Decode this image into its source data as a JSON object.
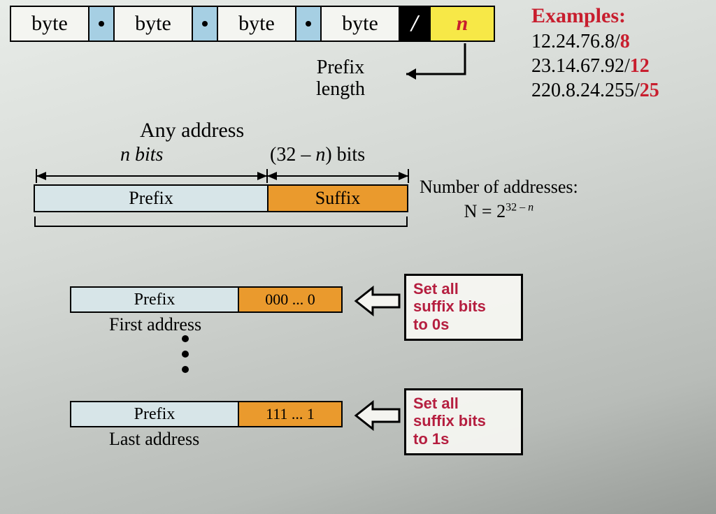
{
  "notation": {
    "byte": "byte",
    "slash": "/",
    "n": "n"
  },
  "examples": {
    "header": "Examples:",
    "rows": [
      {
        "ip": "12.24.76.8/",
        "suf": "8"
      },
      {
        "ip": "23.14.67.92/",
        "suf": "12"
      },
      {
        "ip": "220.8.24.255/",
        "suf": "25"
      }
    ]
  },
  "prefix_length": {
    "line1": "Prefix",
    "line2": "length"
  },
  "any_address": "Any address",
  "bits": {
    "left_html": "<i>n</i> bits",
    "right_html": "(32 – <i>n</i>) bits"
  },
  "mainbar": {
    "prefix": "Prefix",
    "suffix": "Suffix"
  },
  "num_addresses": {
    "line1": "Number of addresses:",
    "line2_html": "N = 2<sup>32 – <i>n</i></sup>"
  },
  "first": {
    "prefix": "Prefix",
    "suffix": "000 ... 0",
    "label": "First address"
  },
  "last": {
    "prefix": "Prefix",
    "suffix": "111 ... 1",
    "label": "Last address"
  },
  "callout": {
    "first": {
      "l1": "Set all",
      "l2": "suffix bits",
      "l3": "to 0s"
    },
    "last": {
      "l1": "Set all",
      "l2": "suffix bits",
      "l3": "to 1s"
    }
  }
}
